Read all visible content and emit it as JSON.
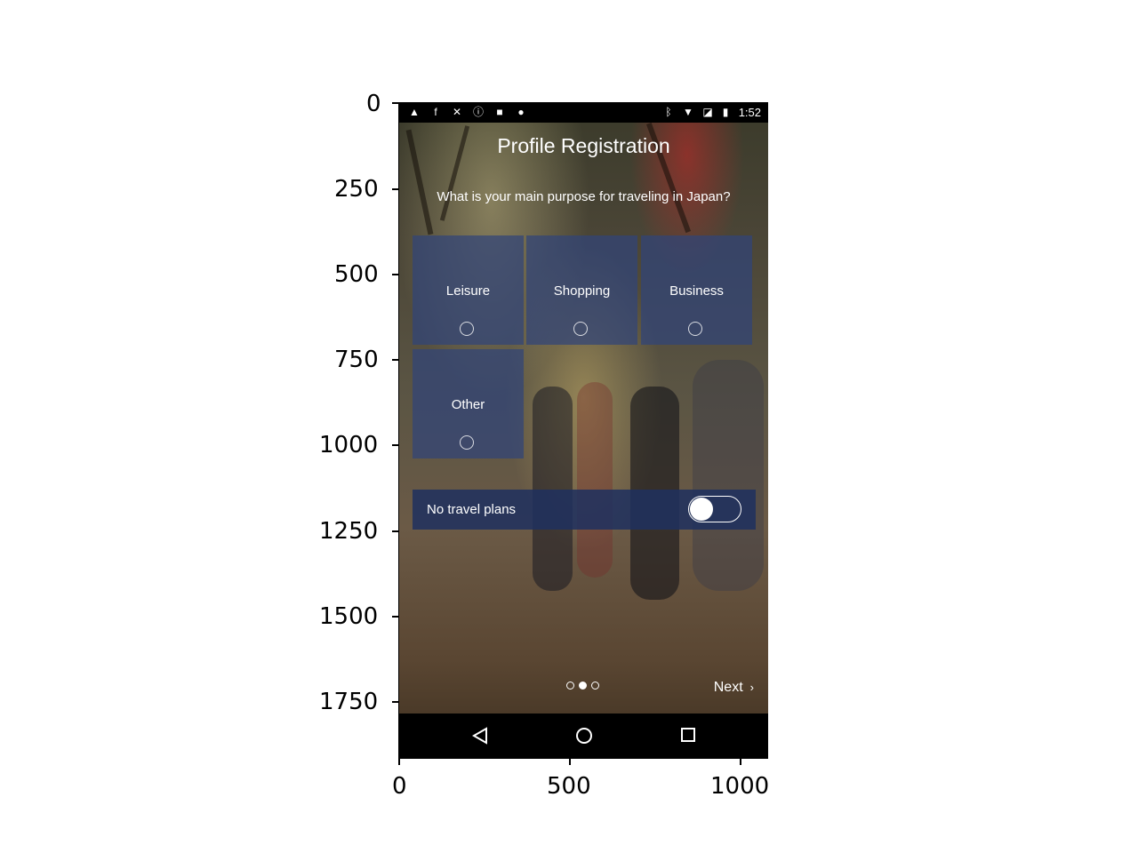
{
  "figure": {
    "y_ticks": [
      "0",
      "250",
      "500",
      "750",
      "1000",
      "1250",
      "1500",
      "1750"
    ],
    "x_ticks": [
      "0",
      "500",
      "1000"
    ]
  },
  "status_bar": {
    "time": "1:52",
    "left_icons": [
      "warning-icon",
      "facebook-icon",
      "wifi-off-icon",
      "info-circle-icon",
      "lock-icon",
      "android-icon"
    ],
    "right_icons": [
      "bluetooth-icon",
      "wifi-icon",
      "no-sim-icon",
      "battery-icon"
    ]
  },
  "header": {
    "title": "Profile Registration"
  },
  "question": "What is your main purpose for traveling in Japan?",
  "options": [
    {
      "label": "Leisure",
      "selected": false
    },
    {
      "label": "Shopping",
      "selected": false
    },
    {
      "label": "Business",
      "selected": false
    },
    {
      "label": "Other",
      "selected": false
    }
  ],
  "no_travel": {
    "label": "No travel plans",
    "on": false
  },
  "pager": {
    "pages": 3,
    "current": 2
  },
  "next": {
    "label": "Next"
  },
  "nav_bar": {
    "icons": [
      "back-icon",
      "home-icon",
      "recents-icon"
    ]
  },
  "colors": {
    "tile": "#304478",
    "toggle_row": "#1e305f",
    "bars": "#000000",
    "text": "#ffffff"
  }
}
